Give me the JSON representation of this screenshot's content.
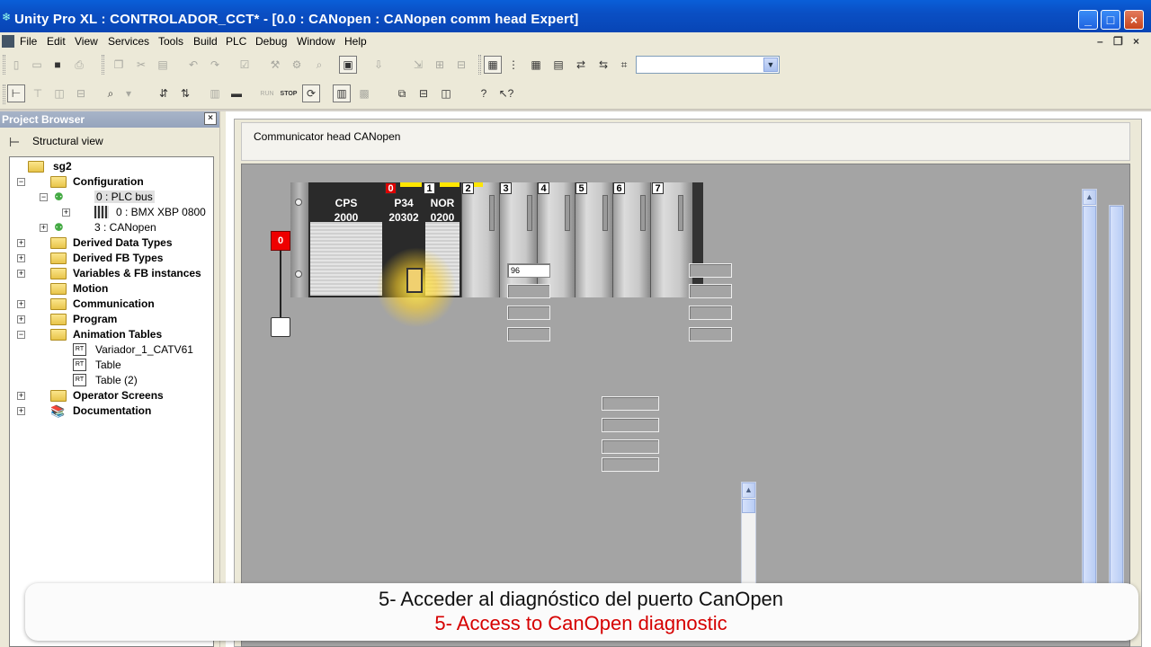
{
  "window": {
    "title": "Unity Pro XL : CONTROLADOR_CCT* - [0.0 : CANopen : CANopen comm head Expert]",
    "minimize": "_",
    "maximize": "□",
    "close": "×"
  },
  "menu": {
    "items": [
      "File",
      "Edit",
      "View",
      "Services",
      "Tools",
      "Build",
      "PLC",
      "Debug",
      "Window",
      "Help"
    ],
    "mdi_minimize": "–",
    "mdi_restore": "❐",
    "mdi_close": "×"
  },
  "toolbar": {
    "search_combo_value": "",
    "run_label": "RUN",
    "stop_label": "STOP"
  },
  "project_browser": {
    "header": "Project Browser",
    "close": "×",
    "view_label": "Structural view",
    "tree": {
      "root": "sg2",
      "configuration": "Configuration",
      "plc_bus": "0 : PLC bus",
      "rack": "0 : BMX XBP 0800",
      "canopen": "3 : CANopen",
      "derived_data_types": "Derived Data Types",
      "derived_fb_types": "Derived FB Types",
      "variables": "Variables & FB instances",
      "motion": "Motion",
      "communication": "Communication",
      "program": "Program",
      "animation_tables": "Animation Tables",
      "anim_1": "Variador_1_CATV61",
      "anim_2": "Table",
      "anim_3": "Table (2)",
      "operator_screens": "Operator Screens",
      "documentation": "Documentation"
    }
  },
  "editor": {
    "header_label": "Communicator head CANopen",
    "bus_node_label": "0",
    "modules": {
      "cps_line1": "CPS",
      "cps_line2": "2000",
      "cpu_line1": "P34",
      "cpu_line2": "20302",
      "nor_line1": "NOR",
      "nor_line2": "0200"
    },
    "slots": [
      "0",
      "1",
      "2",
      "3",
      "4",
      "5",
      "6",
      "7"
    ],
    "field_value": "96"
  },
  "subtitles": {
    "spanish": "5- Acceder al diagnóstico del puerto CanOpen",
    "english": "5- Access to CanOpen diagnostic"
  }
}
